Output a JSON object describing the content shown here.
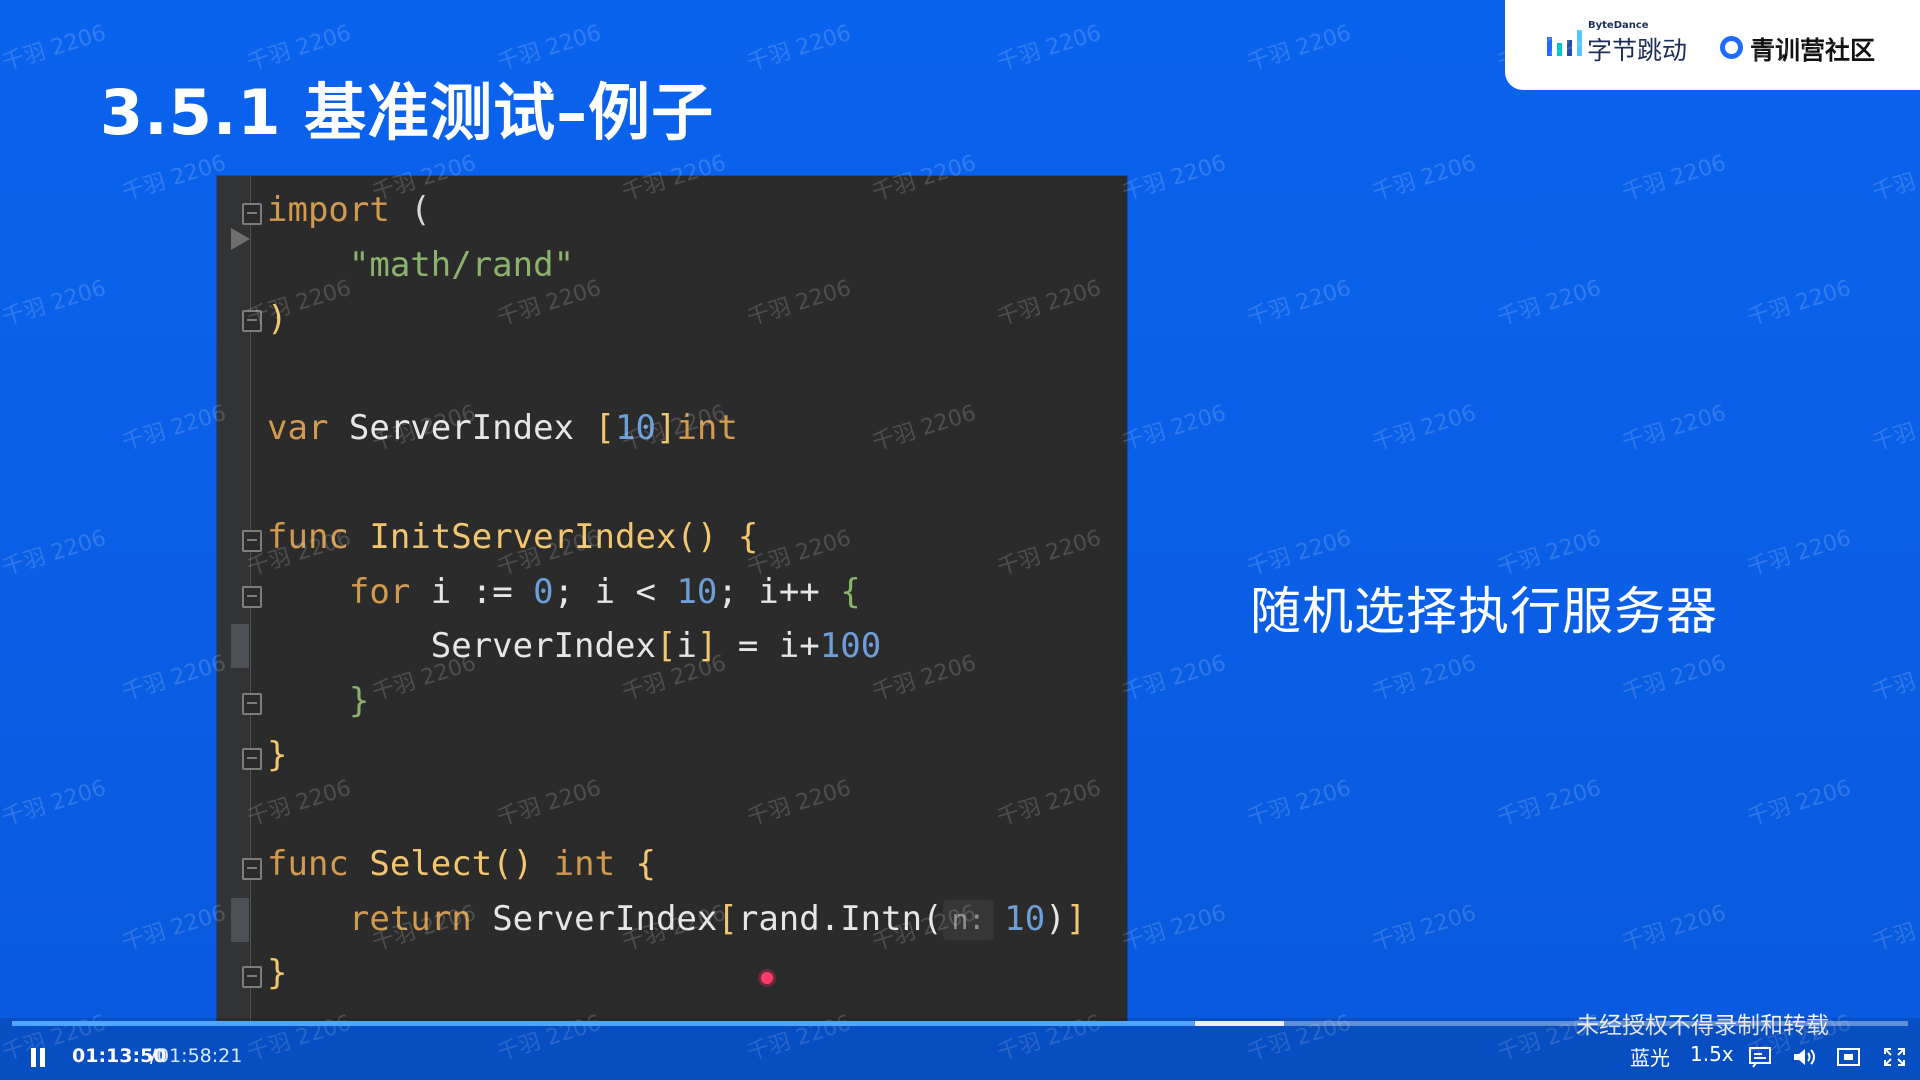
{
  "slide": {
    "title": "3.5.1 基准测试–例子",
    "annotation": "随机选择执行服务器",
    "watermark": "千羽 2206"
  },
  "brand": {
    "small_label": "ByteDance",
    "name": "字节跳动",
    "community": "青训营社区"
  },
  "code": {
    "lines": [
      {
        "tokens": [
          {
            "text": "import",
            "class": "kw"
          },
          {
            "text": " (",
            "class": "op"
          }
        ]
      },
      {
        "indent": 2,
        "tokens": [
          {
            "text": "\"math/rand\"",
            "class": "str"
          }
        ]
      },
      {
        "tokens": [
          {
            "text": ")",
            "class": "fn"
          }
        ]
      },
      {
        "tokens": []
      },
      {
        "tokens": [
          {
            "text": "var",
            "class": "kw"
          },
          {
            "text": " ServerIndex ",
            "class": "ident"
          },
          {
            "text": "[",
            "class": "fn"
          },
          {
            "text": "10",
            "class": "num"
          },
          {
            "text": "]",
            "class": "fn"
          },
          {
            "text": "int",
            "class": "kw"
          }
        ]
      },
      {
        "tokens": []
      },
      {
        "tokens": [
          {
            "text": "func",
            "class": "kw"
          },
          {
            "text": " ",
            "class": "op"
          },
          {
            "text": "InitServerIndex",
            "class": "fn"
          },
          {
            "text": "() {",
            "class": "fn"
          }
        ]
      },
      {
        "indent": 2,
        "tokens": [
          {
            "text": "for",
            "class": "kw"
          },
          {
            "text": " i := ",
            "class": "ident"
          },
          {
            "text": "0",
            "class": "num"
          },
          {
            "text": "; i < ",
            "class": "ident"
          },
          {
            "text": "10",
            "class": "num"
          },
          {
            "text": "; i++ ",
            "class": "ident"
          },
          {
            "text": "{",
            "class": "str"
          }
        ]
      },
      {
        "indent": 4,
        "tokens": [
          {
            "text": "ServerIndex",
            "class": "ident"
          },
          {
            "text": "[",
            "class": "fn"
          },
          {
            "text": "i",
            "class": "ident"
          },
          {
            "text": "]",
            "class": "fn"
          },
          {
            "text": " = i+",
            "class": "ident"
          },
          {
            "text": "100",
            "class": "num"
          }
        ]
      },
      {
        "indent": 2,
        "tokens": [
          {
            "text": "}",
            "class": "str"
          }
        ]
      },
      {
        "tokens": [
          {
            "text": "}",
            "class": "fn"
          }
        ]
      },
      {
        "tokens": []
      },
      {
        "tokens": [
          {
            "text": "func",
            "class": "kw"
          },
          {
            "text": " ",
            "class": "op"
          },
          {
            "text": "Select",
            "class": "fn"
          },
          {
            "text": "() ",
            "class": "fn"
          },
          {
            "text": "int",
            "class": "kw"
          },
          {
            "text": " {",
            "class": "fn"
          }
        ]
      },
      {
        "indent": 2,
        "tokens": [
          {
            "text": "return",
            "class": "kw"
          },
          {
            "text": " ServerIndex",
            "class": "ident"
          },
          {
            "text": "[",
            "class": "fn"
          },
          {
            "text": "rand.Intn(",
            "class": "ident"
          },
          {
            "text": "n:",
            "class": "hint"
          },
          {
            "text": "10",
            "class": "num"
          },
          {
            "text": ")",
            "class": "ident"
          },
          {
            "text": "]",
            "class": "fn"
          }
        ]
      },
      {
        "tokens": [
          {
            "text": "}",
            "class": "fn"
          }
        ]
      }
    ]
  },
  "player": {
    "notice": "未经授权不得录制和转载",
    "current_time": "01:13:50",
    "separator": "/",
    "duration": "01:58:21",
    "quality": "蓝光",
    "speed": "1.5x",
    "played_fraction": 0.6236,
    "buffer_start_fraction": 0.6238,
    "buffer_end_fraction": 0.671,
    "colors": {
      "background": "#0a63ee",
      "progress": "#51a4ff",
      "code_background": "#2b2b2b"
    }
  }
}
